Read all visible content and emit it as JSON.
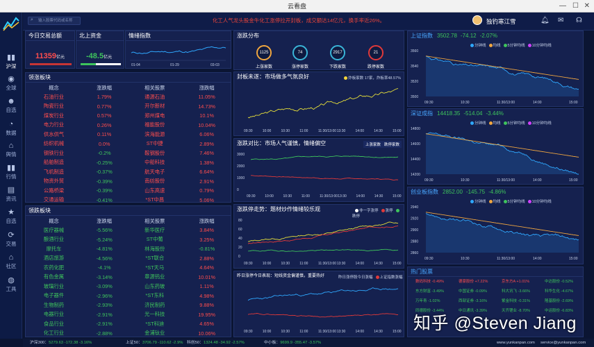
{
  "window": {
    "title": "云看盘"
  },
  "topbar": {
    "search_placeholder": "输入股票代码或名称",
    "ticker": "化工人气龙头股金牛化工涨停拉开封板，成交额达14亿元，换手率近26%。",
    "user_name": "独钓寒江雪"
  },
  "sidebar": {
    "items": [
      {
        "label": "沪深",
        "icon": "bar-chart-icon",
        "active": true
      },
      {
        "label": "全球",
        "icon": "globe-icon"
      },
      {
        "label": "自选",
        "icon": "users-icon"
      },
      {
        "label": "数据",
        "icon": "pie-chart-icon"
      },
      {
        "label": "舆情",
        "icon": "bank-icon"
      },
      {
        "label": "行情",
        "icon": "bar-chart-icon"
      },
      {
        "label": "资讯",
        "icon": "doc-icon"
      },
      {
        "label": "自选",
        "icon": "star-icon"
      },
      {
        "label": "交易",
        "icon": "refresh-icon"
      },
      {
        "label": "社区",
        "icon": "home-icon"
      },
      {
        "label": "工具",
        "icon": "compass-icon"
      }
    ]
  },
  "summary": {
    "trade_title": "今日交易总额",
    "trade_value": "11359",
    "trade_unit": "亿元",
    "north_title": "北上资金",
    "north_value": "-48.5",
    "north_unit": "亿元",
    "mood_title": "情绪指数",
    "mood_xticks": [
      "01-04",
      "01-29",
      "03-03"
    ]
  },
  "leading": {
    "title": "领涨板块",
    "headers": [
      "概念",
      "涨跌幅",
      "相关股票",
      "涨跌幅"
    ],
    "rows": [
      [
        "石油行业",
        "1.79%",
        "通源石油",
        "11.05%"
      ],
      [
        "陶瓷行业",
        "0.77%",
        "开尔新材",
        "14.73%"
      ],
      [
        "煤炭行业",
        "0.57%",
        "郑州煤电",
        "10.1%"
      ],
      [
        "电力行业",
        "0.26%",
        "福能股份",
        "10.04%"
      ],
      [
        "供水供气",
        "0.11%",
        "滨海能源",
        "6.06%"
      ],
      [
        "纺织机械",
        "0.0%",
        "ST中捷",
        "2.89%"
      ],
      [
        "钢铁行业",
        "-0.2%",
        "鞍钢股份",
        "7.46%"
      ],
      [
        "船舶制造",
        "-0.25%",
        "中船科技",
        "1.38%"
      ],
      [
        "飞机制造",
        "-0.37%",
        "航天电子",
        "6.64%"
      ],
      [
        "物资外贸",
        "-0.39%",
        "南纺股份",
        "2.91%"
      ],
      [
        "公路桥梁",
        "-0.39%",
        "山东高速",
        "0.79%"
      ],
      [
        "交通运输",
        "-0.41%",
        "*ST中昌",
        "5.06%"
      ]
    ]
  },
  "falling": {
    "title": "领跌板块",
    "headers": [
      "概念",
      "涨跌幅",
      "相关股票",
      "涨跌幅"
    ],
    "rows": [
      [
        "医疗器械",
        "-5.56%",
        "新华医疗",
        "3.84%"
      ],
      [
        "酿酒行业",
        "-5.24%",
        "ST中葡",
        "3.25%"
      ],
      [
        "摩托车",
        "-4.81%",
        "林海股份",
        "-0.81%"
      ],
      [
        "酒店旅游",
        "-4.56%",
        "*ST联合",
        "2.88%"
      ],
      [
        "农药化肥",
        "-4.1%",
        "*ST天马",
        "4.64%"
      ],
      [
        "有色金属",
        "-3.14%",
        "章源钨业",
        "10.01%"
      ],
      [
        "玻璃行业",
        "-3.09%",
        "山东药玻",
        "1.11%"
      ],
      [
        "电子器件",
        "-2.96%",
        "*ST东科",
        "4.98%"
      ],
      [
        "生物制药",
        "-2.93%",
        "济民制药",
        "9.88%"
      ],
      [
        "电器行业",
        "-2.91%",
        "光一科技",
        "19.95%"
      ],
      [
        "食品行业",
        "-2.91%",
        "*ST科迪",
        "4.65%"
      ],
      [
        "化工行业",
        "-2.88%",
        "金浦钛业",
        "10.06%"
      ]
    ]
  },
  "dist": {
    "title": "涨跌分布",
    "items": [
      {
        "value": "1125",
        "label": "上涨家数"
      },
      {
        "value": "74",
        "label": "涨停家数"
      },
      {
        "value": "2917",
        "label": "下跌家数"
      },
      {
        "value": "21",
        "label": "跌停家数"
      }
    ]
  },
  "seal": {
    "title": "封板未遂：市场做多气氛良好",
    "legend": "炸板家数 17家，炸板率48.57%"
  },
  "contrast": {
    "title": "涨跌对比：市场人气谨慎，情绪偏空",
    "btn1": "上涨家数",
    "btn2": "跌停家数"
  },
  "limit": {
    "title": "涨跌停走势：题材炒作情绪较乐观",
    "legend1": "非一字涨停",
    "legend2": "涨停",
    "legend3": "跌停"
  },
  "yesterday": {
    "title": "昨日涨停今日表现：短线资金偏谨慎，重要热好",
    "legend1": "昨日涨停股今日涨幅",
    "legend2": "上证指数涨幅"
  },
  "time_ticks": [
    "09:30",
    "10:00",
    "10:30",
    "11:00",
    "11:30/13:00",
    "13:30",
    "14:00",
    "14:30",
    "15:00"
  ],
  "idx": [
    {
      "name": "上证指数",
      "price": "3502.78",
      "chg": "-74.12",
      "pct": "-2.07%",
      "yticks": [
        "3560",
        "3540",
        "3520",
        "3500"
      ]
    },
    {
      "name": "深证成指",
      "price": "14418.35",
      "chg": "-514.04",
      "pct": "-3.44%",
      "yticks": [
        "14800",
        "14600",
        "14400",
        "14200"
      ]
    },
    {
      "name": "创业板指数",
      "price": "2852.00",
      "chg": "-145.75",
      "pct": "-4.86%",
      "yticks": [
        "2940",
        "2920",
        "2900",
        "2880",
        "2860"
      ]
    }
  ],
  "idx_legend": [
    "分钟线",
    "均线",
    "5分钟均线",
    "10分钟均线"
  ],
  "idx_x": [
    "09:30",
    "10:30",
    "11:30/13:00",
    "14:00",
    "15:00"
  ],
  "hot": {
    "title": "热门股票",
    "rows": [
      [
        [
          "数码科技 -0.49%",
          "red"
        ],
        [
          "德豪股份 +7.22%",
          "red"
        ],
        [
          "京东方A +1.01%",
          "red"
        ],
        [
          "中达股份 -0.52%",
          "green"
        ]
      ],
      [
        [
          "东方财富 -3.49%",
          "green"
        ],
        [
          "中国证券 -0.09%",
          "green"
        ],
        [
          "科大讯飞 -3.66%",
          "green"
        ],
        [
          "科华生化 -4.67%",
          "green"
        ]
      ],
      [
        [
          "万年青 -1.02%",
          "green"
        ],
        [
          "西部证券 -3.16%",
          "green"
        ],
        [
          "紫金科技 -0.31%",
          "green"
        ],
        [
          "隆基股份 -2.69%",
          "green"
        ]
      ],
      [
        [
          "同德股份 -3.44%",
          "green"
        ],
        [
          "中日通讯 -3.39%",
          "green"
        ],
        [
          "天齐锂业 -8.70%",
          "green"
        ],
        [
          "中运股份 -6.83%",
          "green"
        ]
      ]
    ]
  },
  "watermark": "知乎 @Steven Jiang",
  "bottom": {
    "items": [
      {
        "name": "沪深300：",
        "val": "5279.63 -172.38 -3.16%"
      },
      {
        "name": "上证50：",
        "val": "3706.79 -110.62 -2.9%"
      },
      {
        "name": "科创50：",
        "val": "1324.48 -34.92 -2.57%"
      },
      {
        "name": "中小板：",
        "val": "9699.9 -355.47 -3.57%"
      }
    ],
    "site": "www.yunkanpan.com",
    "email": "service@yunkanpan.com"
  }
}
